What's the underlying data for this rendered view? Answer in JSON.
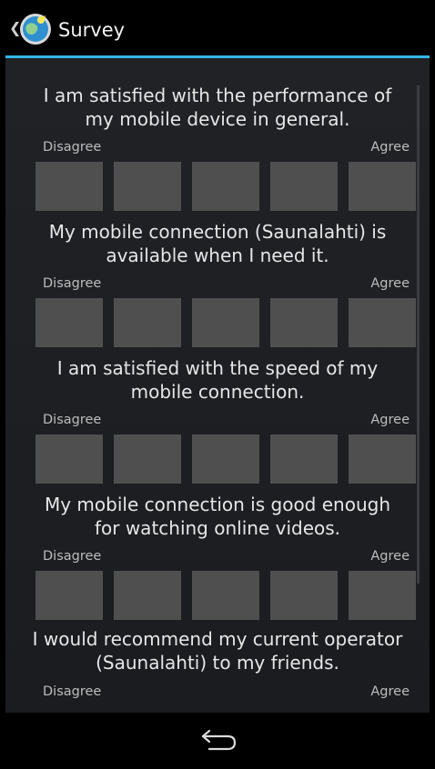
{
  "actionbar": {
    "title": "Survey",
    "up_icon": "chevron-left-icon",
    "app_icon": "globe-app-icon",
    "accent": "#33b5e5"
  },
  "survey": {
    "questions": [
      {
        "line1": "I am satisfied with the performance of",
        "line2": "my mobile device in general.",
        "left": "Disagree",
        "right": "Agree"
      },
      {
        "line1": "My mobile connection (Saunalahti) is",
        "line2": "available when I need it.",
        "left": "Disagree",
        "right": "Agree"
      },
      {
        "line1": "I am satisfied with the speed of my",
        "line2": "mobile connection.",
        "left": "Disagree",
        "right": "Agree"
      },
      {
        "line1": "My mobile connection is good enough",
        "line2": "for watching online videos.",
        "left": "Disagree",
        "right": "Agree"
      },
      {
        "line1": "I would recommend my current operator",
        "line2": "(Saunalahti) to my friends.",
        "left": "Disagree",
        "right": "Agree"
      }
    ]
  },
  "navbar": {
    "back_icon": "back-arrow-icon"
  }
}
